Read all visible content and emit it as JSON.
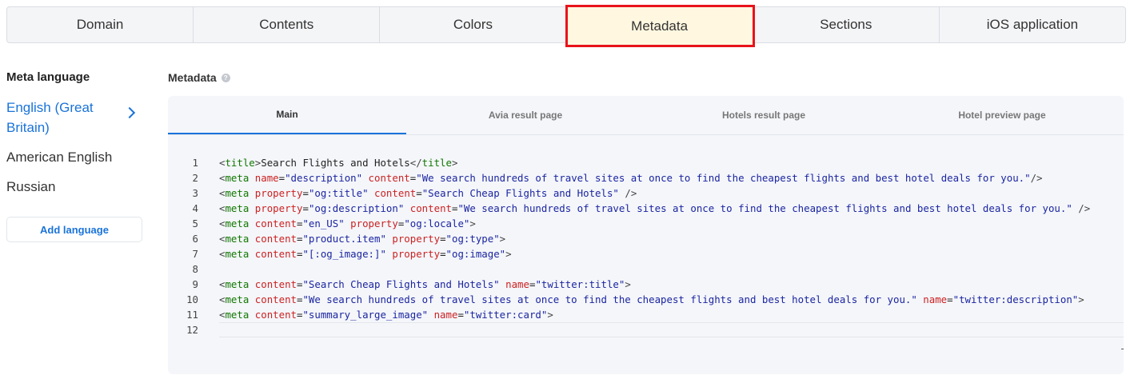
{
  "top_tabs": [
    "Domain",
    "Contents",
    "Colors",
    "Metadata",
    "Sections",
    "iOS application"
  ],
  "active_top_tab": "Metadata",
  "meta_language": {
    "title": "Meta language",
    "languages": [
      "English (Great Britain)",
      "American English",
      "Russian"
    ],
    "add_language_label": "Add language"
  },
  "metadata": {
    "title": "Metadata",
    "help_icon": "question-icon",
    "sub_tabs": [
      "Main",
      "Avia result page",
      "Hotels result page",
      "Hotel preview page"
    ],
    "active_sub_tab": "Main",
    "line_numbers": [
      "1",
      "2",
      "3",
      "4",
      "5",
      "6",
      "7",
      "8",
      "9",
      "10",
      "11",
      "12"
    ],
    "code_lines": [
      [
        {
          "t": "b",
          "v": "<"
        },
        {
          "t": "tag",
          "v": "title"
        },
        {
          "t": "b",
          "v": ">"
        },
        {
          "t": "p",
          "v": "Search Flights and Hotels"
        },
        {
          "t": "b",
          "v": "</"
        },
        {
          "t": "tag",
          "v": "title"
        },
        {
          "t": "b",
          "v": ">"
        }
      ],
      [
        {
          "t": "b",
          "v": "<"
        },
        {
          "t": "tag",
          "v": "meta"
        },
        {
          "t": "p",
          "v": " "
        },
        {
          "t": "attr",
          "v": "name"
        },
        {
          "t": "p",
          "v": "="
        },
        {
          "t": "val",
          "v": "\"description\""
        },
        {
          "t": "p",
          "v": " "
        },
        {
          "t": "attr",
          "v": "content"
        },
        {
          "t": "p",
          "v": "="
        },
        {
          "t": "val",
          "v": "\"We search hundreds of travel sites at once to find the cheapest flights and best hotel deals for you.\""
        },
        {
          "t": "b",
          "v": "/>"
        }
      ],
      [
        {
          "t": "b",
          "v": "<"
        },
        {
          "t": "tag",
          "v": "meta"
        },
        {
          "t": "p",
          "v": " "
        },
        {
          "t": "attr",
          "v": "property"
        },
        {
          "t": "p",
          "v": "="
        },
        {
          "t": "val",
          "v": "\"og:title\""
        },
        {
          "t": "p",
          "v": " "
        },
        {
          "t": "attr",
          "v": "content"
        },
        {
          "t": "p",
          "v": "="
        },
        {
          "t": "val",
          "v": "\"Search Cheap Flights and Hotels\""
        },
        {
          "t": "p",
          "v": " "
        },
        {
          "t": "b",
          "v": "/>"
        }
      ],
      [
        {
          "t": "b",
          "v": "<"
        },
        {
          "t": "tag",
          "v": "meta"
        },
        {
          "t": "p",
          "v": " "
        },
        {
          "t": "attr",
          "v": "property"
        },
        {
          "t": "p",
          "v": "="
        },
        {
          "t": "val",
          "v": "\"og:description\""
        },
        {
          "t": "p",
          "v": " "
        },
        {
          "t": "attr",
          "v": "content"
        },
        {
          "t": "p",
          "v": "="
        },
        {
          "t": "val",
          "v": "\"We search hundreds of travel sites at once to find the cheapest flights and best hotel deals for you.\""
        },
        {
          "t": "p",
          "v": " "
        },
        {
          "t": "b",
          "v": "/>"
        }
      ],
      [
        {
          "t": "b",
          "v": "<"
        },
        {
          "t": "tag",
          "v": "meta"
        },
        {
          "t": "p",
          "v": " "
        },
        {
          "t": "attr",
          "v": "content"
        },
        {
          "t": "p",
          "v": "="
        },
        {
          "t": "val",
          "v": "\"en_US\""
        },
        {
          "t": "p",
          "v": " "
        },
        {
          "t": "attr",
          "v": "property"
        },
        {
          "t": "p",
          "v": "="
        },
        {
          "t": "val",
          "v": "\"og:locale\""
        },
        {
          "t": "b",
          "v": ">"
        }
      ],
      [
        {
          "t": "b",
          "v": "<"
        },
        {
          "t": "tag",
          "v": "meta"
        },
        {
          "t": "p",
          "v": " "
        },
        {
          "t": "attr",
          "v": "content"
        },
        {
          "t": "p",
          "v": "="
        },
        {
          "t": "val",
          "v": "\"product.item\""
        },
        {
          "t": "p",
          "v": " "
        },
        {
          "t": "attr",
          "v": "property"
        },
        {
          "t": "p",
          "v": "="
        },
        {
          "t": "val",
          "v": "\"og:type\""
        },
        {
          "t": "b",
          "v": ">"
        }
      ],
      [
        {
          "t": "b",
          "v": "<"
        },
        {
          "t": "tag",
          "v": "meta"
        },
        {
          "t": "p",
          "v": " "
        },
        {
          "t": "attr",
          "v": "content"
        },
        {
          "t": "p",
          "v": "="
        },
        {
          "t": "val",
          "v": "\"[:og_image:]\""
        },
        {
          "t": "p",
          "v": " "
        },
        {
          "t": "attr",
          "v": "property"
        },
        {
          "t": "p",
          "v": "="
        },
        {
          "t": "val",
          "v": "\"og:image\""
        },
        {
          "t": "b",
          "v": ">"
        }
      ],
      [],
      [
        {
          "t": "b",
          "v": "<"
        },
        {
          "t": "tag",
          "v": "meta"
        },
        {
          "t": "p",
          "v": " "
        },
        {
          "t": "attr",
          "v": "content"
        },
        {
          "t": "p",
          "v": "="
        },
        {
          "t": "val",
          "v": "\"Search Cheap Flights and Hotels\""
        },
        {
          "t": "p",
          "v": " "
        },
        {
          "t": "attr",
          "v": "name"
        },
        {
          "t": "p",
          "v": "="
        },
        {
          "t": "val",
          "v": "\"twitter:title\""
        },
        {
          "t": "b",
          "v": ">"
        }
      ],
      [
        {
          "t": "b",
          "v": "<"
        },
        {
          "t": "tag",
          "v": "meta"
        },
        {
          "t": "p",
          "v": " "
        },
        {
          "t": "attr",
          "v": "content"
        },
        {
          "t": "p",
          "v": "="
        },
        {
          "t": "val",
          "v": "\"We search hundreds of travel sites at once to find the cheapest flights and best hotel deals for you.\""
        },
        {
          "t": "p",
          "v": " "
        },
        {
          "t": "attr",
          "v": "name"
        },
        {
          "t": "p",
          "v": "="
        },
        {
          "t": "val",
          "v": "\"twitter:description\""
        },
        {
          "t": "b",
          "v": ">"
        }
      ],
      [
        {
          "t": "b",
          "v": "<"
        },
        {
          "t": "tag",
          "v": "meta"
        },
        {
          "t": "p",
          "v": " "
        },
        {
          "t": "attr",
          "v": "content"
        },
        {
          "t": "p",
          "v": "="
        },
        {
          "t": "val",
          "v": "\"summary_large_image\""
        },
        {
          "t": "p",
          "v": " "
        },
        {
          "t": "attr",
          "v": "name"
        },
        {
          "t": "p",
          "v": "="
        },
        {
          "t": "val",
          "v": "\"twitter:card\""
        },
        {
          "t": "b",
          "v": ">"
        }
      ],
      []
    ]
  },
  "colors": {
    "accent_blue": "#1a73d9",
    "active_highlight_border": "#e8131b",
    "active_tab_bg": "#fff7e0",
    "tag_color": "#117700",
    "attr_color": "#cc2222",
    "value_color": "#1b25a0"
  }
}
